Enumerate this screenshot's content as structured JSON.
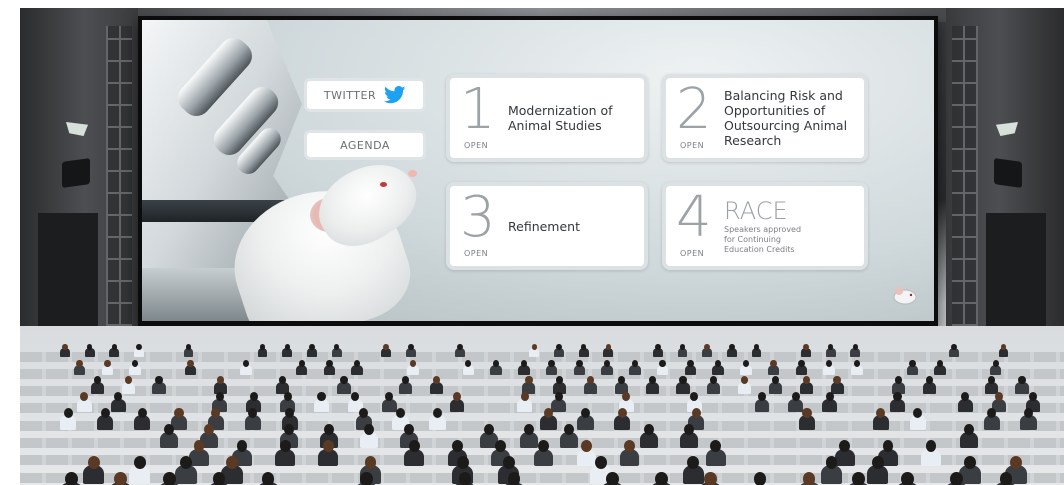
{
  "buttons": {
    "twitter_label": "TWITTER",
    "agenda_label": "AGENDA"
  },
  "sessions": [
    {
      "number": "1",
      "title_lines": [
        "Modernization of",
        "Animal Studies"
      ],
      "status": "OPEN"
    },
    {
      "number": "2",
      "title_lines": [
        "Balancing Risk and",
        "Opportunities of",
        "Outsourcing Animal",
        "Research"
      ],
      "status": "OPEN"
    },
    {
      "number": "3",
      "title_lines": [
        "Refinement"
      ],
      "status": "OPEN"
    },
    {
      "number": "4",
      "title": "RACE",
      "subtitle_lines": [
        "Speakers approved",
        "for Continuing",
        "Education Credits"
      ],
      "status": "OPEN"
    }
  ],
  "colors": {
    "twitter_blue": "#1da1f2",
    "tile_border": "#dce2e4",
    "number_grey": "#9ca2a5"
  },
  "icons": {
    "twitter": "twitter-bird-icon",
    "logo": "mouse-logo-icon"
  }
}
